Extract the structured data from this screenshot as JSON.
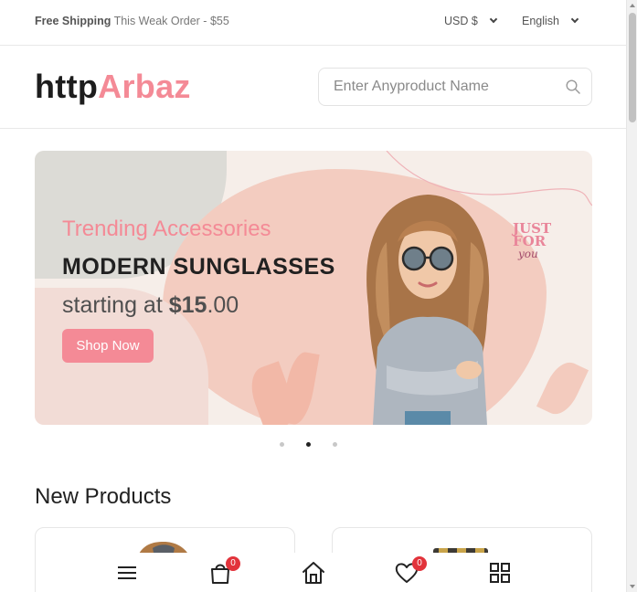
{
  "topbar": {
    "shipping_bold": "Free Shipping",
    "shipping_text": "This Weak Order - $55",
    "currency": "USD $",
    "language": "English"
  },
  "header": {
    "logo_part1": "http",
    "logo_part2": "Arbaz",
    "search_placeholder": "Enter Anyproduct Name",
    "search_icon": "search-icon"
  },
  "banner": {
    "subtitle": "Trending Accessories",
    "title": "MODERN SUNGLASSES",
    "price_prefix": "starting at ",
    "price_bold": "$15",
    "price_suffix": ".00",
    "button_label": "Shop Now",
    "stamp_line1": "JUST",
    "stamp_line2": "FOR",
    "stamp_line3": "you",
    "slides_total": 3,
    "active_slide": 2
  },
  "products": {
    "section_title": "New Products"
  },
  "bottom_nav": {
    "items": [
      {
        "icon": "menu-icon"
      },
      {
        "icon": "bag-icon",
        "badge": "0"
      },
      {
        "icon": "home-icon"
      },
      {
        "icon": "heart-icon",
        "badge": "0"
      },
      {
        "icon": "grid-icon"
      }
    ]
  },
  "colors": {
    "accent": "#f48a96",
    "badge": "#e2333b",
    "text": "#212121"
  }
}
